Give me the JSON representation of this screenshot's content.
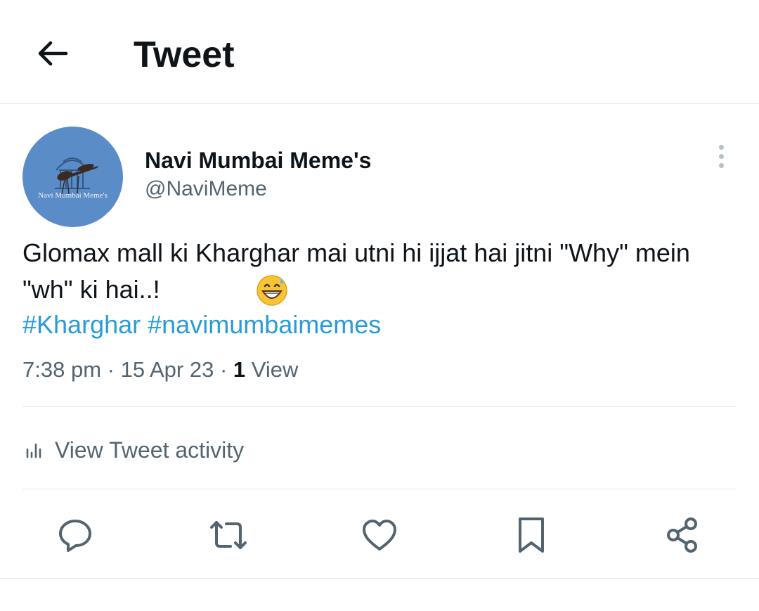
{
  "header": {
    "back_icon": "arrow-left-icon",
    "title": "Tweet"
  },
  "tweet": {
    "author": {
      "display_name": "Navi Mumbai Meme's",
      "handle": "@NaviMeme",
      "avatar_text": "Navi Mumbai Meme's",
      "avatar_color": "#5a8cc7"
    },
    "more_icon": "more-vertical-icon",
    "text": "Glomax mall ki Kharghar mai utni hi ijjat hai jitni \"Why\" mein \"wh\" ki hai..!",
    "emoji": "grinning-face-with-sweat-emoji",
    "hashtags": [
      "#Kharghar",
      "#navimumbaimemes"
    ],
    "hashtag_color": "#2a9bd8",
    "meta": {
      "time": "7:38 pm",
      "separator": "·",
      "date": "15 Apr 23",
      "views_count": "1",
      "views_label": "View"
    },
    "activity": {
      "icon": "bar-chart-icon",
      "label": "View Tweet activity"
    },
    "actions": [
      {
        "name": "reply",
        "icon": "reply-icon"
      },
      {
        "name": "retweet",
        "icon": "retweet-icon"
      },
      {
        "name": "like",
        "icon": "heart-icon"
      },
      {
        "name": "bookmark",
        "icon": "bookmark-icon"
      },
      {
        "name": "share",
        "icon": "share-icon"
      }
    ]
  }
}
